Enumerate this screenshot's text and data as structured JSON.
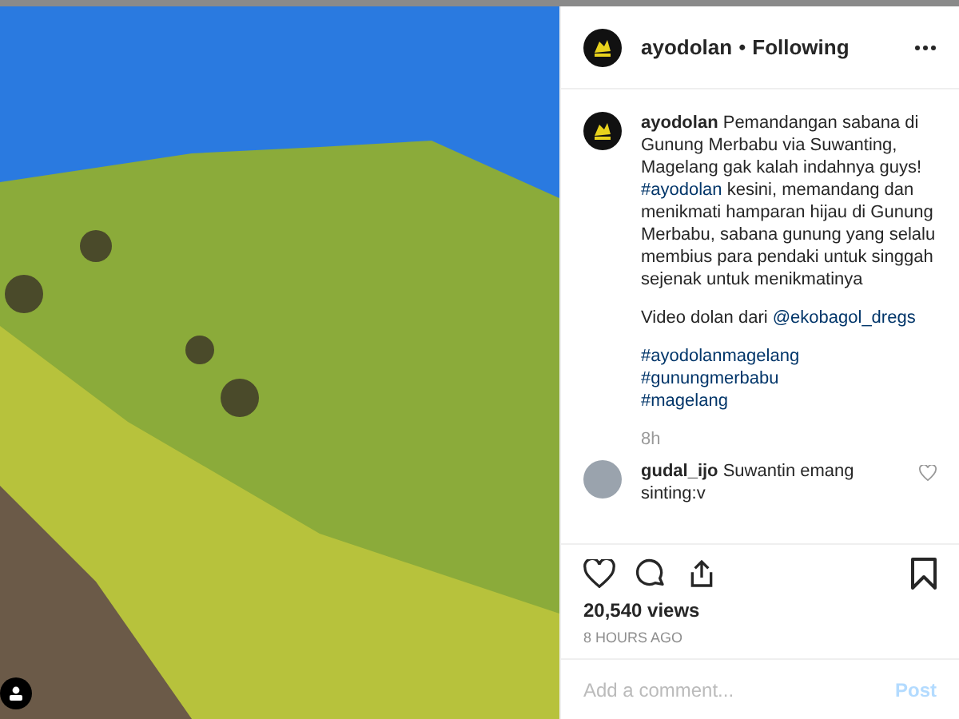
{
  "post": {
    "username": "ayodolan",
    "separator": "•",
    "follow_label": "Following"
  },
  "caption": {
    "username": "ayodolan",
    "paragraphs": [
      {
        "kind": "inline",
        "parts": [
          {
            "kind": "text",
            "text": " Pemandangan sabana di Gunung Merbabu via Suwanting, Magelang gak kalah indahnya guys! "
          },
          {
            "kind": "link",
            "text": "#ayodolan"
          },
          {
            "kind": "text",
            "text": " kesini, memandang dan menikmati hamparan hijau di Gunung Merbabu, sabana gunung yang selalu membius para pendaki untuk singgah sejenak untuk menikmatinya"
          }
        ]
      },
      {
        "kind": "inline",
        "parts": [
          {
            "kind": "text",
            "text": "Video dolan dari "
          },
          {
            "kind": "link",
            "text": "@ekobagol_dregs"
          }
        ]
      },
      {
        "kind": "lines",
        "parts": [
          {
            "kind": "link",
            "text": "#ayodolanmagelang"
          },
          {
            "kind": "link",
            "text": "#gunungmerbabu"
          },
          {
            "kind": "link",
            "text": "#magelang"
          }
        ]
      }
    ],
    "time": "8h"
  },
  "comments": [
    {
      "username": "gudal_ijo",
      "text": " Suwantin emang sinting:v",
      "liked": false
    }
  ],
  "views": "20,540 views",
  "posted": "8 HOURS AGO",
  "comment_field": {
    "placeholder": "Add a comment...",
    "button": "Post"
  }
}
